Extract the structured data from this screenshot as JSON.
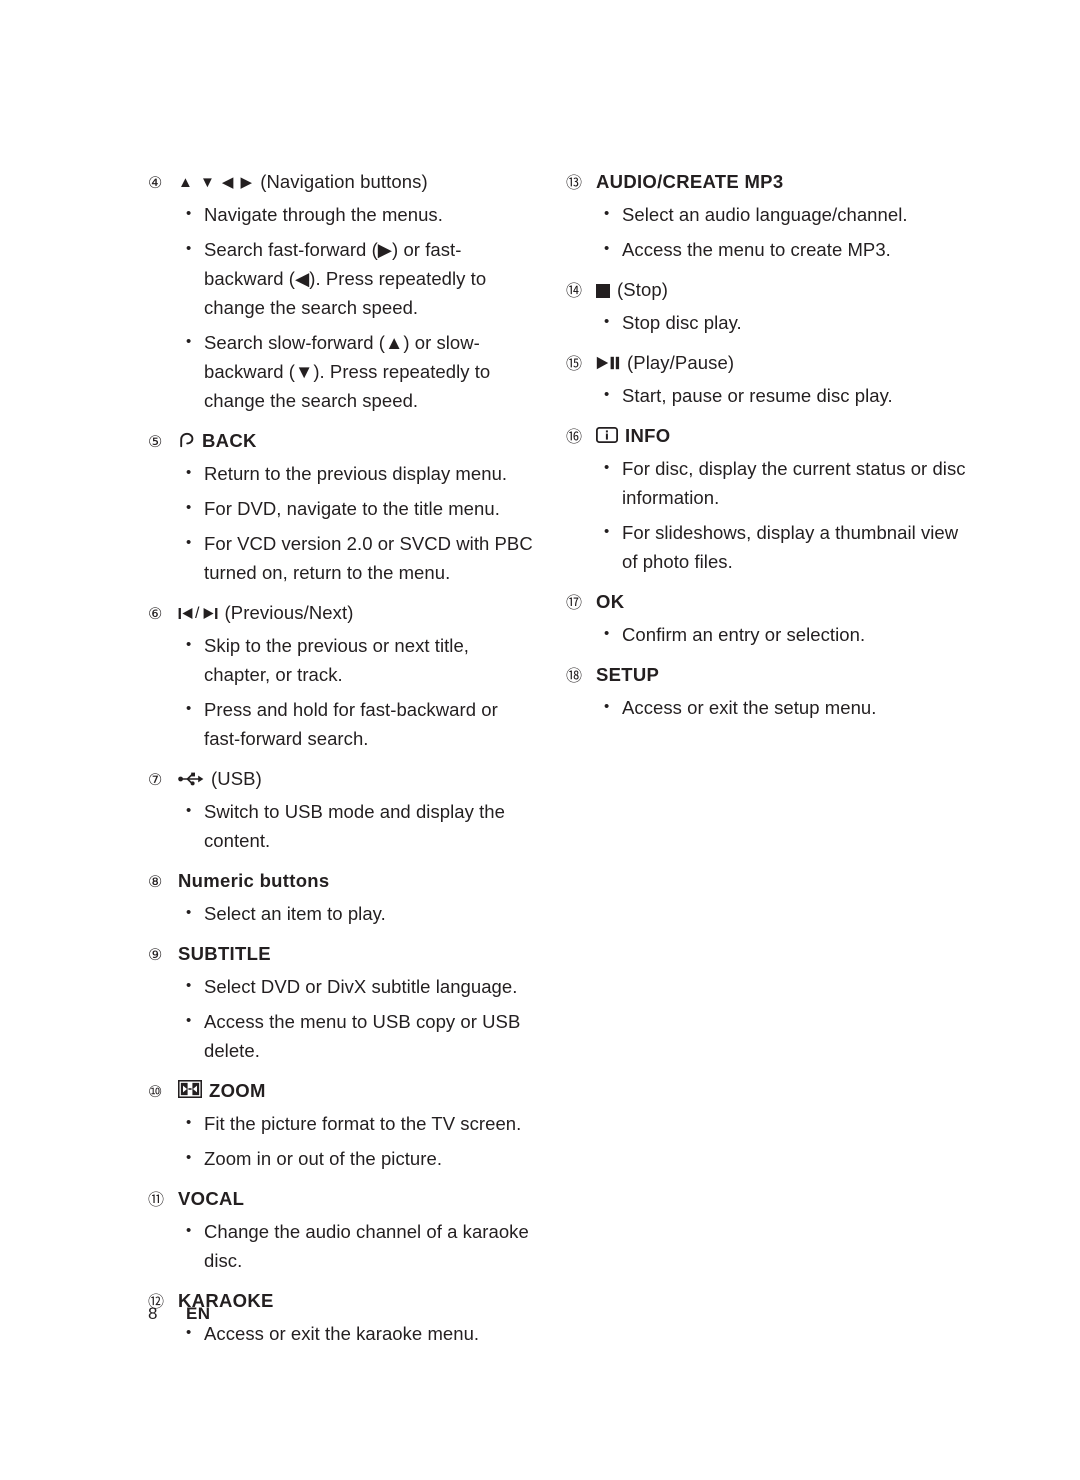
{
  "footer": {
    "page_number": "8",
    "locale": "EN"
  },
  "left_column": [
    {
      "number": "4",
      "icon": "navigation-arrows-icon",
      "label": "",
      "paren": "(Navigation buttons)",
      "bullets": [
        "Navigate through the menus.",
        "Search fast-forward (▶) or fast-backward (◀). Press repeatedly to change the search speed.",
        "Search slow-forward (▲) or slow-backward (▼). Press repeatedly to change the search speed."
      ]
    },
    {
      "number": "5",
      "icon": "back-return-arrow-icon",
      "label": "BACK",
      "paren": "",
      "bullets": [
        "Return to the previous display menu.",
        "For DVD, navigate to the title menu.",
        "For VCD version 2.0 or SVCD with PBC turned on, return to the menu."
      ]
    },
    {
      "number": "6",
      "icon": "previous-next-icon",
      "label": "",
      "paren": "(Previous/Next)",
      "bullets": [
        "Skip to the previous or next title, chapter, or track.",
        "Press and hold for fast-backward or fast-forward search."
      ]
    },
    {
      "number": "7",
      "icon": "usb-icon",
      "label": "",
      "paren": "(USB)",
      "bullets": [
        "Switch to USB mode and display the content."
      ]
    },
    {
      "number": "8",
      "icon": "",
      "label": "Numeric buttons",
      "paren": "",
      "bullets": [
        "Select an item to play."
      ]
    },
    {
      "number": "9",
      "icon": "",
      "label": "SUBTITLE",
      "paren": "",
      "bullets": [
        "Select DVD or DivX subtitle language.",
        "Access the menu to USB copy or USB delete."
      ]
    },
    {
      "number": "10",
      "icon": "zoom-icon",
      "label": "ZOOM",
      "paren": "",
      "bullets": [
        "Fit the picture format to the TV screen.",
        "Zoom in or out of the picture."
      ]
    },
    {
      "number": "11",
      "icon": "",
      "label": "VOCAL",
      "paren": "",
      "bullets": [
        "Change the audio channel of a karaoke disc."
      ]
    },
    {
      "number": "12",
      "icon": "",
      "label": "KARAOKE",
      "paren": "",
      "bullets": [
        "Access or exit the karaoke menu."
      ]
    }
  ],
  "right_column": [
    {
      "number": "13",
      "icon": "",
      "label": "AUDIO/CREATE MP3",
      "paren": "",
      "bullets": [
        "Select an audio language/channel.",
        "Access the menu to create MP3."
      ]
    },
    {
      "number": "14",
      "icon": "stop-icon",
      "label": "",
      "paren": "(Stop)",
      "bullets": [
        "Stop disc play."
      ]
    },
    {
      "number": "15",
      "icon": "play-pause-icon",
      "label": "",
      "paren": "(Play/Pause)",
      "bullets": [
        "Start, pause or resume disc play."
      ]
    },
    {
      "number": "16",
      "icon": "info-icon",
      "label": "INFO",
      "paren": "",
      "bullets": [
        "For disc, display the current status or disc information.",
        "For slideshows, display a thumbnail view of photo files."
      ]
    },
    {
      "number": "17",
      "icon": "",
      "label": "OK",
      "paren": "",
      "bullets": [
        "Confirm an entry or selection."
      ]
    },
    {
      "number": "18",
      "icon": "",
      "label": "SETUP",
      "paren": "",
      "bullets": [
        "Access or exit the setup menu."
      ]
    }
  ]
}
